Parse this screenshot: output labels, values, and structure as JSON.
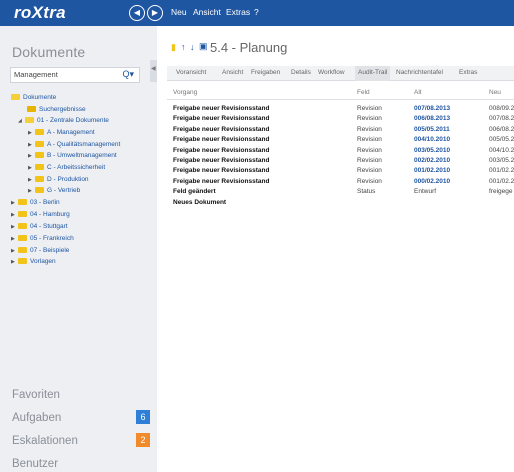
{
  "topbar": {
    "logo": "roXtra",
    "menu": [
      "Neu",
      "Ansicht",
      "Extras",
      "?"
    ]
  },
  "sidebar": {
    "title": "Dokumente",
    "search": {
      "value": "Management"
    },
    "tree": [
      {
        "label": "Dokumente",
        "icon": "folder-open-icon"
      },
      {
        "label": "Suchergebnisse",
        "icon": "search-folder-icon"
      },
      {
        "label": "01 - Zentrale Dokumente",
        "icon": "folder-open-icon"
      },
      {
        "label": "A - Management",
        "icon": "folder-icon"
      },
      {
        "label": "A - Qualitätsmanagement",
        "icon": "folder-icon"
      },
      {
        "label": "B - Umweltmanagement",
        "icon": "folder-icon"
      },
      {
        "label": "C - Arbeitssicherheit",
        "icon": "folder-icon"
      },
      {
        "label": "D - Produktion",
        "icon": "folder-icon"
      },
      {
        "label": "G - Vertrieb",
        "icon": "folder-icon"
      },
      {
        "label": "03 - Berlin",
        "icon": "folder-icon"
      },
      {
        "label": "04 - Hamburg",
        "icon": "folder-icon"
      },
      {
        "label": "04 - Stuttgart",
        "icon": "folder-icon"
      },
      {
        "label": "05 - Frankreich",
        "icon": "folder-icon"
      },
      {
        "label": "07 - Beispiele",
        "icon": "folder-icon"
      },
      {
        "label": "Vorlagen",
        "icon": "folder-icon"
      }
    ],
    "bottom": {
      "favoriten": "Favoriten",
      "aufgaben": "Aufgaben",
      "aufgaben_count": "6",
      "eskalationen": "Eskalationen",
      "eskalationen_count": "2",
      "benutzer": "Benutzer"
    },
    "colors": {
      "aufgaben_badge": "#2f7fd8",
      "eskalationen_badge": "#f08a2b"
    }
  },
  "document": {
    "title": "5.4 - Planung",
    "tabs": [
      "Voransicht",
      "Ansicht",
      "Freigaben",
      "Details",
      "Workflow",
      "Audit-Trail",
      "Nachrichtentafel",
      "Extras"
    ],
    "active_tab": "Audit-Trail"
  },
  "audit": {
    "columns": [
      "Vorgang",
      "Feld",
      "Alt",
      "Neu"
    ],
    "rows": [
      {
        "vorgang": "Freigabe neuer Revisionsstand",
        "feld": "Revision",
        "alt": "007/08.2013",
        "neu": "008/09.2"
      },
      {
        "vorgang": "Freigabe neuer Revisionsstand",
        "feld": "Revision",
        "alt": "006/08.2013",
        "neu": "007/08.2"
      },
      {
        "vorgang": "Freigabe neuer Revisionsstand",
        "feld": "Revision",
        "alt": "005/05.2011",
        "neu": "006/08.2"
      },
      {
        "vorgang": "Freigabe neuer Revisionsstand",
        "feld": "Revision",
        "alt": "004/10.2010",
        "neu": "005/05.2"
      },
      {
        "vorgang": "Freigabe neuer Revisionsstand",
        "feld": "Revision",
        "alt": "003/05.2010",
        "neu": "004/10.2"
      },
      {
        "vorgang": "Freigabe neuer Revisionsstand",
        "feld": "Revision",
        "alt": "002/02.2010",
        "neu": "003/05.2"
      },
      {
        "vorgang": "Freigabe neuer Revisionsstand",
        "feld": "Revision",
        "alt": "001/02.2010",
        "neu": "001/02.2"
      },
      {
        "vorgang": "Freigabe neuer Revisionsstand",
        "feld": "Revision",
        "alt": "000/02.2010",
        "neu": "001/02.2"
      },
      {
        "vorgang": "Feld geändert",
        "feld": "Status",
        "alt": "Entwurf",
        "neu": "freigege"
      },
      {
        "vorgang": "Neues Dokument",
        "feld": "",
        "alt": "",
        "neu": ""
      }
    ]
  }
}
